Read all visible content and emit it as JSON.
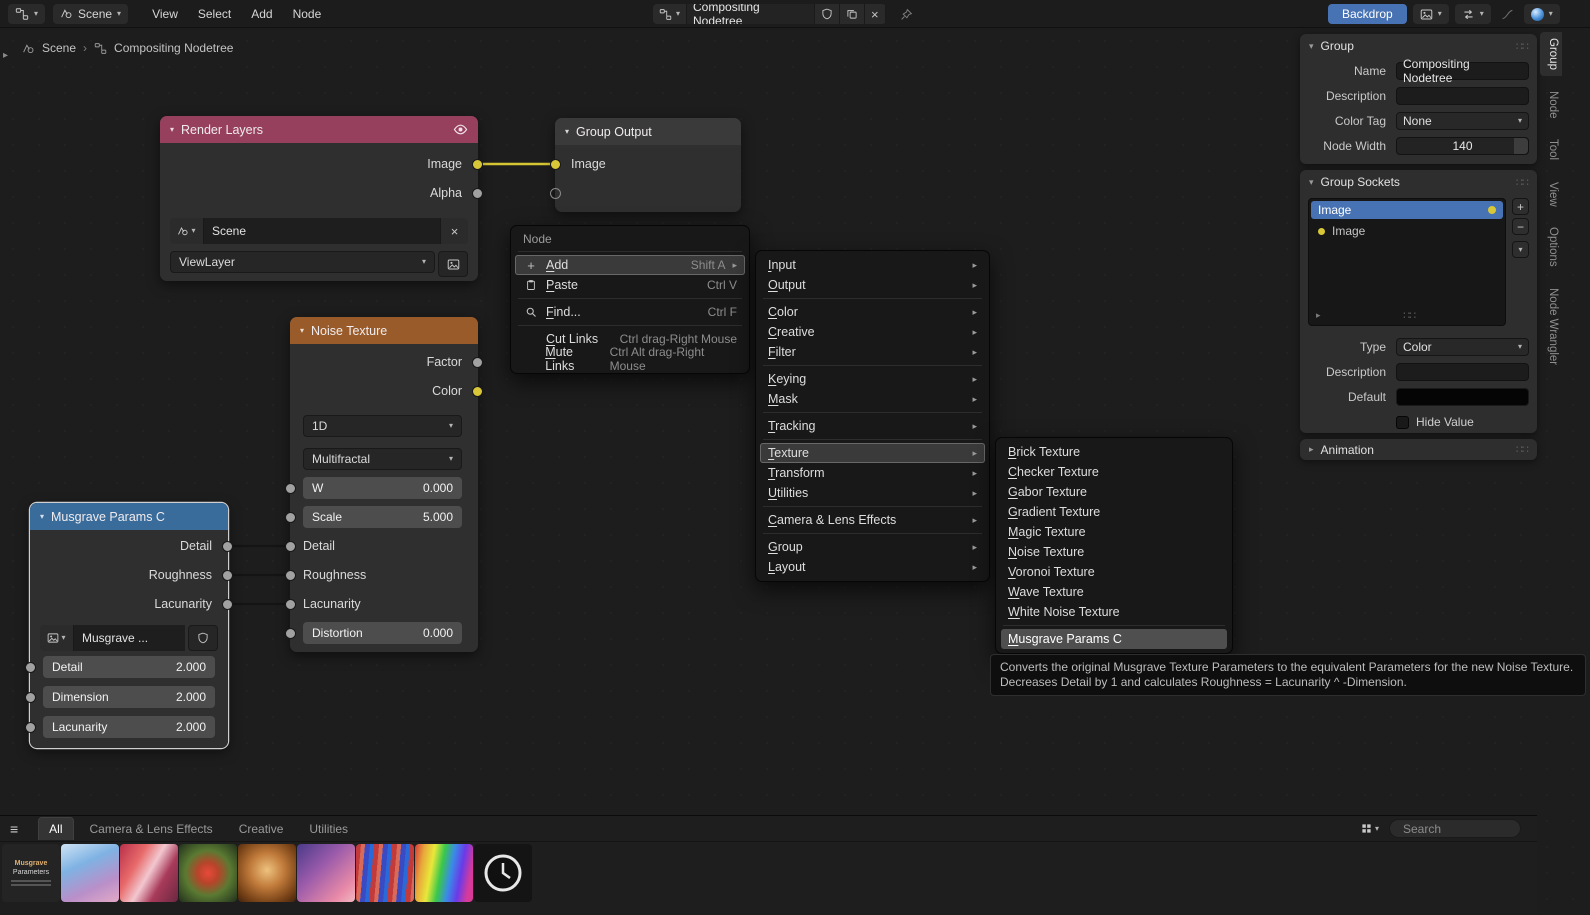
{
  "colors": {
    "accent_blue": "#4772b3",
    "render_layers_header": "#96405e",
    "texture_node_header": "#9a5b2b",
    "group_node_header": "#3a6c9b",
    "output_node_header": "#3a3a3a",
    "socket_yellow": "#d8c837",
    "socket_gray": "#a1a1a1",
    "noodle_yellow": "#d6c532"
  },
  "topbar": {
    "scene_selector": "Scene",
    "menus": [
      "View",
      "Select",
      "Add",
      "Node"
    ],
    "id_name": "Compositing Nodetree",
    "backdrop_button": "Backdrop"
  },
  "breadcrumb": {
    "scene": "Scene",
    "separator": "›",
    "tree": "Compositing Nodetree"
  },
  "nodes": {
    "render_layers": {
      "title": "Render Layers",
      "output_image": "Image",
      "output_alpha": "Alpha",
      "scene_field": "Scene",
      "viewlayer_field": "ViewLayer"
    },
    "group_output": {
      "title": "Group Output",
      "input_image": "Image"
    },
    "noise_texture": {
      "title": "Noise Texture",
      "output_factor": "Factor",
      "output_color": "Color",
      "dimensions_value": "1D",
      "type_value": "Multifractal",
      "w_label": "W",
      "w_value": "0.000",
      "scale_label": "Scale",
      "scale_value": "5.000",
      "detail_label": "Detail",
      "roughness_label": "Roughness",
      "lacunarity_label": "Lacunarity",
      "distortion_label": "Distortion",
      "distortion_value": "0.000"
    },
    "musgrave_params": {
      "title": "Musgrave Params C",
      "output_detail": "Detail",
      "output_roughness": "Roughness",
      "output_lacunarity": "Lacunarity",
      "group_selector_value": "Musgrave ...",
      "detail_label": "Detail",
      "detail_value": "2.000",
      "dimension_label": "Dimension",
      "dimension_value": "2.000",
      "lacunarity_label": "Lacunarity",
      "lacunarity_value": "2.000"
    }
  },
  "context_menu": {
    "title": "Node",
    "add_label": "Add",
    "add_shortcut": "Shift A",
    "paste_label": "Paste",
    "paste_shortcut": "Ctrl V",
    "find_label": "Find...",
    "find_shortcut": "Ctrl F",
    "cut_links_label": "Cut Links",
    "cut_links_shortcut": "Ctrl drag-Right Mouse",
    "mute_links_label": "Mute Links",
    "mute_links_shortcut": "Ctrl Alt drag-Right Mouse"
  },
  "add_submenu": {
    "items": [
      "Input",
      "Output",
      "Color",
      "Creative",
      "Filter",
      "Keying",
      "Mask",
      "Tracking",
      "Texture",
      "Transform",
      "Utilities",
      "Camera & Lens Effects",
      "Group",
      "Layout"
    ]
  },
  "texture_submenu": {
    "items": [
      "Brick Texture",
      "Checker Texture",
      "Gabor Texture",
      "Gradient Texture",
      "Magic Texture",
      "Noise Texture",
      "Voronoi Texture",
      "Wave Texture",
      "White Noise Texture"
    ],
    "highlighted_item": "Musgrave Params C"
  },
  "tooltip": {
    "line1": "Converts the original Musgrave Texture Parameters to the equivalent Parameters for the new Noise Texture.",
    "line2": "Decreases Detail by 1 and calculates Roughness = Lacunarity ^ -Dimension."
  },
  "sidebar": {
    "group_panel": {
      "title": "Group",
      "name_label": "Name",
      "name_value": "Compositing Nodetree",
      "description_label": "Description",
      "description_value": "",
      "color_tag_label": "Color Tag",
      "color_tag_value": "None",
      "node_width_label": "Node Width",
      "node_width_value": "140"
    },
    "sockets_panel": {
      "title": "Group Sockets",
      "list_selected": "Image",
      "list_child": "Image",
      "type_label": "Type",
      "type_value": "Color",
      "description_label": "Description",
      "description_value": "",
      "default_label": "Default",
      "hide_value_label": "Hide Value"
    },
    "animation_panel": {
      "title": "Animation"
    },
    "tabs": [
      "Group",
      "Node",
      "Tool",
      "View",
      "Options",
      "Node Wrangler"
    ],
    "active_tab": "Group"
  },
  "asset_shelf": {
    "tabs": [
      "All",
      "Camera & Lens Effects",
      "Creative",
      "Utilities"
    ],
    "active_tab": "All",
    "search_placeholder": "Search",
    "asset_caption_line1": "Musgrave",
    "asset_caption_line2": "Parameters"
  }
}
